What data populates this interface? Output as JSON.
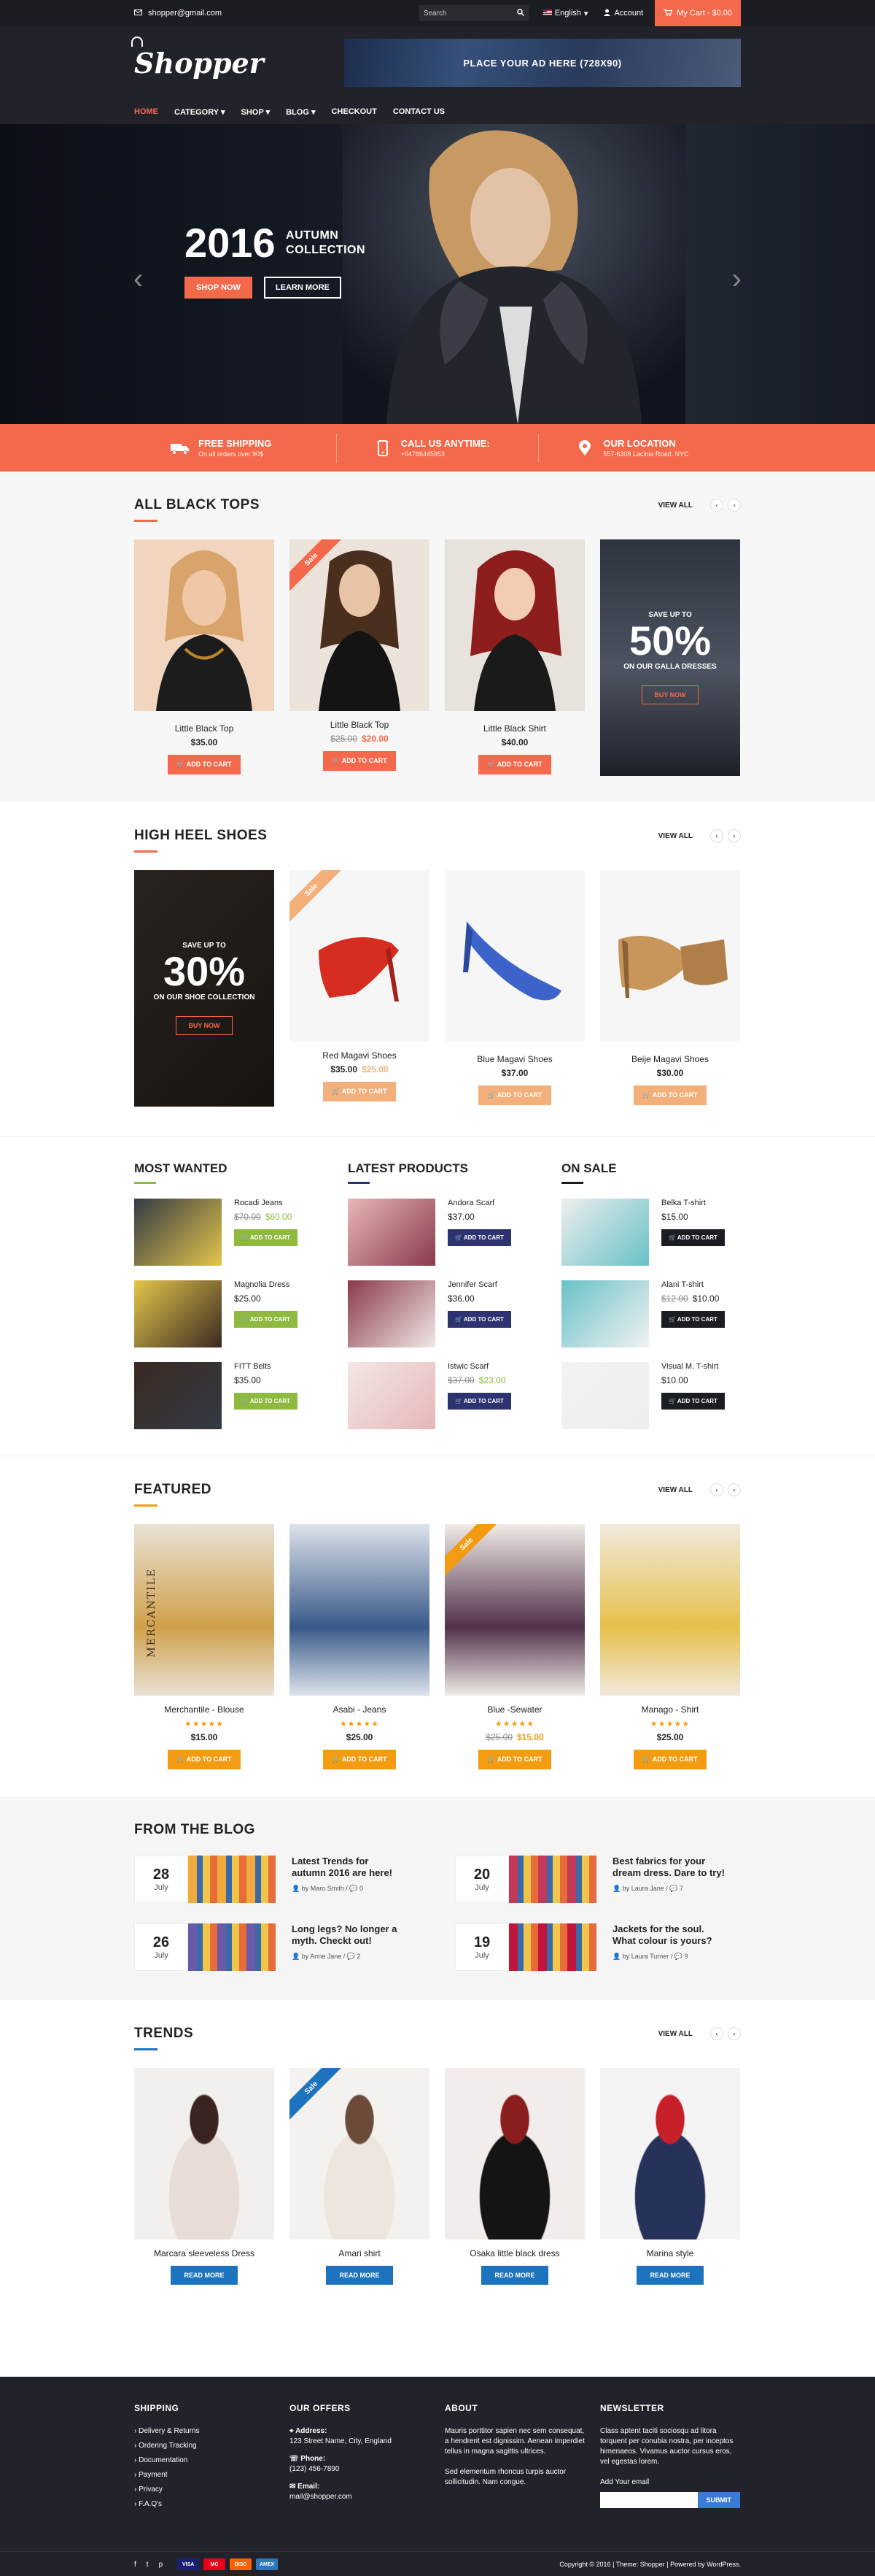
{
  "topbar": {
    "email": "shopper@gmail.com",
    "search_placeholder": "Search",
    "language": "English",
    "account": "Account",
    "cart": "My Cart - $0.00"
  },
  "header": {
    "logo": "Shopper",
    "ad_text": "PLACE YOUR AD HERE (728X90)",
    "nav": [
      "HOME",
      "CATEGORY",
      "SHOP",
      "BLOG",
      "CHECKOUT",
      "CONTACT US"
    ]
  },
  "hero": {
    "year": "2016",
    "line1": "AUTUMN",
    "line2": "COLLECTION",
    "shop_now": "SHOP NOW",
    "learn_more": "LEARN MORE"
  },
  "strip": [
    {
      "title": "FREE SHIPPING",
      "sub": "On all orders over 90$"
    },
    {
      "title": "CALL US ANYTIME:",
      "sub": "+04786445953"
    },
    {
      "title": "OUR LOCATION",
      "sub": "557-6308 Lacinia Road. NYC"
    }
  ],
  "black_tops": {
    "title": "ALL BLACK TOPS",
    "view_all": "VIEW ALL",
    "products": [
      {
        "name": "Little Black Top",
        "price": "$35.00",
        "old": "",
        "button": "ADD TO CART"
      },
      {
        "name": "Little Black Top",
        "price": "$20.00",
        "old": "$25.00",
        "button": "ADD TO CART",
        "badge": "Sale"
      },
      {
        "name": "Little Black Shirt",
        "price": "$40.00",
        "old": "",
        "button": "ADD TO CART"
      }
    ],
    "promo": {
      "top": "SAVE UP TO",
      "big": "50%",
      "bottom": "ON OUR GALLA DRESSES",
      "button": "BUY NOW"
    }
  },
  "shoes": {
    "title": "HIGH HEEL SHOES",
    "view_all": "VIEW ALL",
    "promo": {
      "top": "SAVE UP TO",
      "big": "30%",
      "bottom": "ON OUR SHOE COLLECTION",
      "button": "BUY NOW"
    },
    "products": [
      {
        "name": "Red Magavi Shoes",
        "price": "$25.00",
        "old": "$35.00",
        "button": "ADD TO CART",
        "badge": "Sale"
      },
      {
        "name": "Blue Magavi Shoes",
        "price": "$37.00",
        "old": "",
        "button": "ADD TO CART"
      },
      {
        "name": "Beije Magavi Shoes",
        "price": "$30.00",
        "old": "",
        "button": "ADD TO CART"
      }
    ]
  },
  "lists": [
    {
      "title": "MOST WANTED",
      "items": [
        {
          "name": "Rocadi Jeans",
          "price": "$60.00",
          "old": "$70.00",
          "button": "ADD TO CART"
        },
        {
          "name": "Magnolia Dress",
          "price": "$25.00",
          "old": "",
          "button": "ADD TO CART"
        },
        {
          "name": "FITT Belts",
          "price": "$35.00",
          "old": "",
          "button": "ADD TO CART"
        }
      ]
    },
    {
      "title": "LATEST PRODUCTS",
      "items": [
        {
          "name": "Andora Scarf",
          "price": "$37.00",
          "old": "",
          "button": "ADD TO CART"
        },
        {
          "name": "Jennifer Scarf",
          "price": "$36.00",
          "old": "",
          "button": "ADD TO CART"
        },
        {
          "name": "Istwic Scarf",
          "price": "$23.00",
          "old": "$37.00",
          "button": "ADD TO CART"
        }
      ]
    },
    {
      "title": "ON SALE",
      "items": [
        {
          "name": "Belka T-shirt",
          "price": "$15.00",
          "old": "",
          "button": "ADD TO CART"
        },
        {
          "name": "Alani T-shirt",
          "price": "$10.00",
          "old": "$12.00",
          "button": "ADD TO CART"
        },
        {
          "name": "Visual M. T-shirt",
          "price": "$10.00",
          "old": "",
          "button": "ADD TO CART"
        }
      ]
    }
  ],
  "featured": {
    "title": "FEATURED",
    "view_all": "VIEW ALL",
    "stars": "★★★★★",
    "products": [
      {
        "name": "Merchantile - Blouse",
        "price": "$15.00",
        "old": "",
        "button": "ADD TO CART",
        "tag": "MERCANTILE"
      },
      {
        "name": "Asabi - Jeans",
        "price": "$25.00",
        "old": "",
        "button": "ADD TO CART"
      },
      {
        "name": "Blue -Sewater",
        "price": "$15.00",
        "old": "$25.00",
        "button": "ADD TO CART",
        "badge": "Sale"
      },
      {
        "name": "Manago - Shirt",
        "price": "$25.00",
        "old": "",
        "button": "ADD TO CART"
      }
    ]
  },
  "blog": {
    "title": "FROM THE BLOG",
    "posts": [
      {
        "day": "28",
        "month": "July",
        "title": "Latest Trends for autumn 2016 are here!",
        "author": "by Maro Smith",
        "comments": "0"
      },
      {
        "day": "20",
        "month": "July",
        "title": "Best fabrics for your dream dress. Dare to try!",
        "author": "by Laura Jane",
        "comments": "7"
      },
      {
        "day": "26",
        "month": "July",
        "title": "Long legs? No longer a myth. Checkt out!",
        "author": "by Anne Jane",
        "comments": "2"
      },
      {
        "day": "19",
        "month": "July",
        "title": "Jackets for the soul. What colour is yours?",
        "author": "by Laura Turner",
        "comments": "9"
      }
    ]
  },
  "trends": {
    "title": "TRENDS",
    "view_all": "VIEW ALL",
    "products": [
      {
        "name": "Marcara sleeveless Dress",
        "button": "READ MORE"
      },
      {
        "name": "Amari shirt",
        "button": "READ MORE",
        "badge": "Sale"
      },
      {
        "name": "Osaka little black dress",
        "button": "READ MORE"
      },
      {
        "name": "Marina style",
        "button": "READ MORE"
      }
    ]
  },
  "footer": {
    "shipping": {
      "title": "SHIPPING",
      "links": [
        "Delivery & Returns",
        "Ordering Tracking",
        "Documentation",
        "Payment",
        "Privacy",
        "F.A.Q's"
      ]
    },
    "offers": {
      "title": "OUR OFFERS",
      "address_label": "Address:",
      "address": "123 Street Name, City, England",
      "phone_label": "Phone:",
      "phone": "(123) 456-7890",
      "email_label": "Email:",
      "email": "mail@shopper.com"
    },
    "about": {
      "title": "ABOUT",
      "p1": "Mauris porttitor sapien nec sem consequat, a hendrerit est dignissim. Aenean imperdiet tellus in magna sagittis ultrices.",
      "p2": "Sed elementum rhoncus turpis auctor sollicitudin. Nam congue."
    },
    "newsletter": {
      "title": "NEWSLETTER",
      "text": "Class aptent taciti sociosqu ad litora torquent per conubia nostra, per inceptos himenaeos. Vivamus auctor cursus eros, vel egestas lorem.",
      "label": "Add Your email",
      "button": "SUBMIT"
    },
    "payments": [
      "VISA",
      "MC",
      "DISC",
      "AMEX"
    ],
    "copyright": "Copyright © 2016  |  Theme: Shopper  |  Powered by WordPress."
  },
  "colors": {
    "accent": "#f4694b",
    "shoe_accent": "#f4b07a",
    "green": "#8fba3f",
    "navy": "#2d3370",
    "dark": "#1c1d22",
    "featured": "#f39c12",
    "blue": "#1e73be"
  }
}
